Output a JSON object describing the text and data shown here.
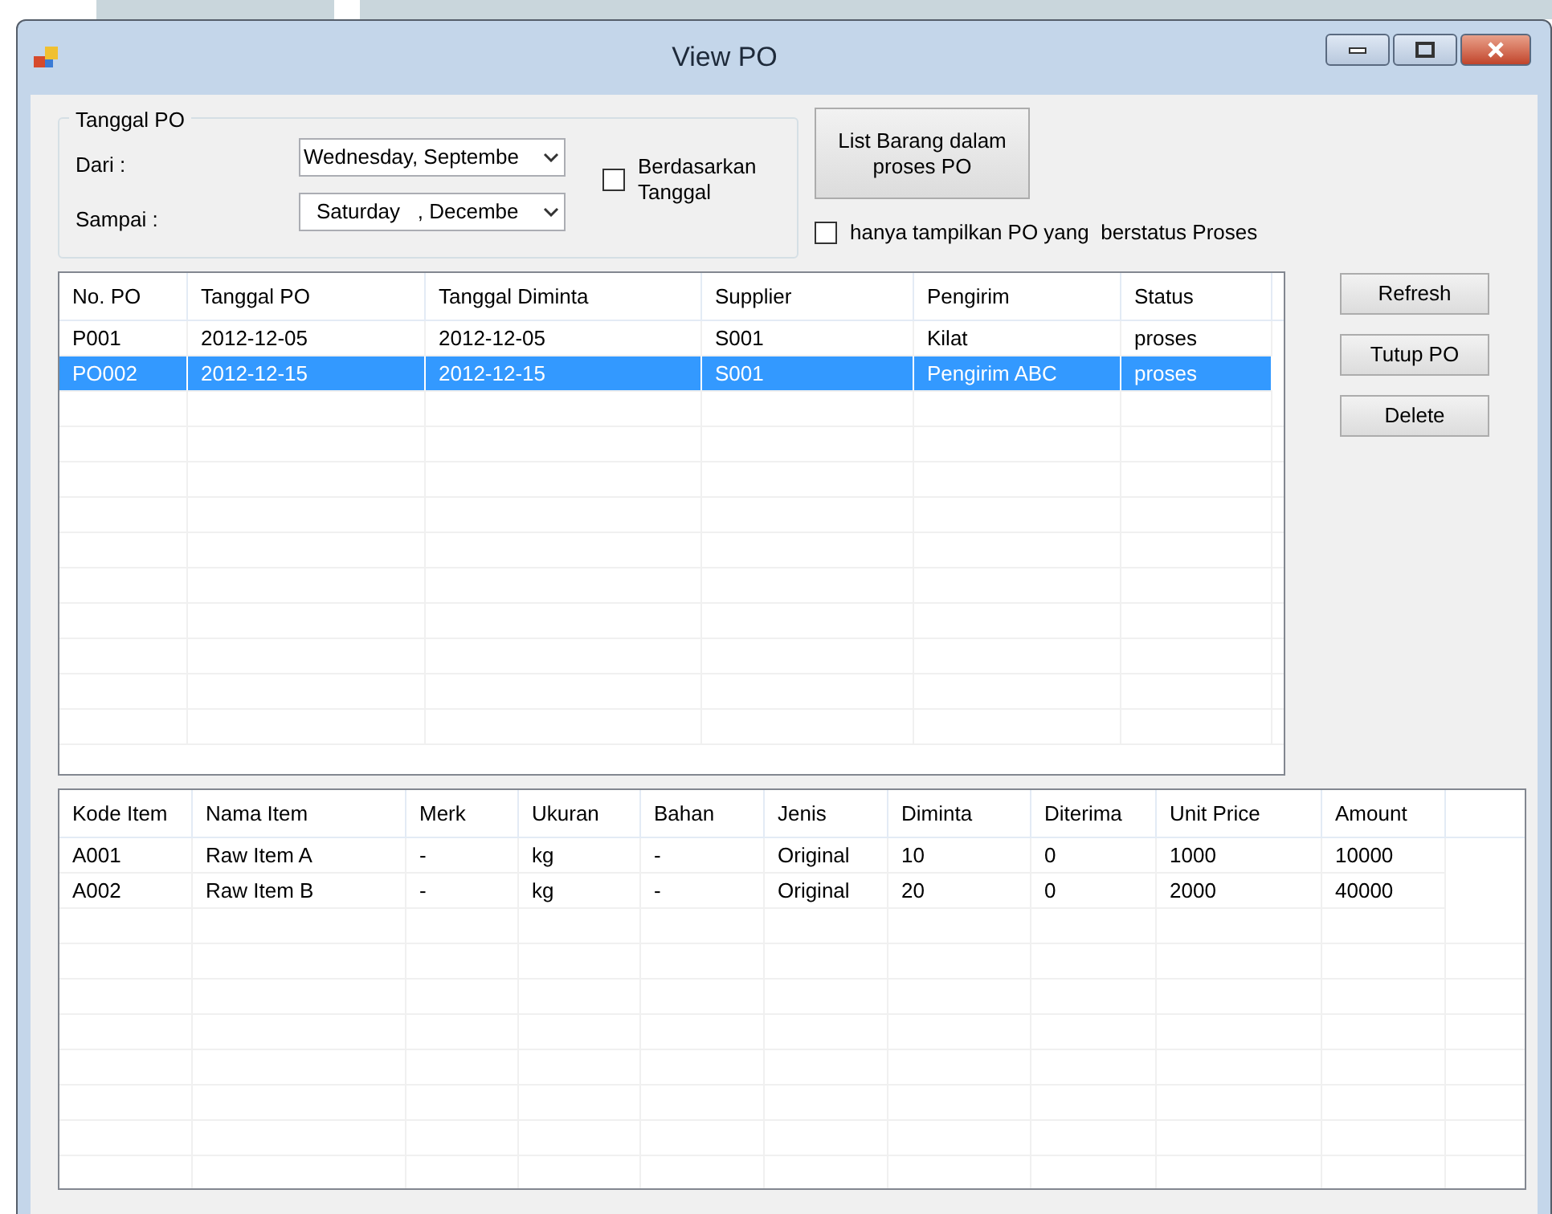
{
  "window": {
    "title": "View PO"
  },
  "filter": {
    "title": "Tanggal PO",
    "from_label": "Dari :",
    "from_value": "Wednesday, Septembe",
    "to_label": "Sampai :",
    "to_value": "Saturday   , Decembe",
    "by_date": {
      "label": "Berdasarkan Tanggal",
      "checked": false
    }
  },
  "list_button": "List Barang dalam proses PO",
  "only_process": {
    "label": "hanya tampilkan PO yang  berstatus Proses",
    "checked": false
  },
  "po_table": {
    "columns": [
      "No. PO",
      "Tanggal PO",
      "Tanggal Diminta",
      "Supplier",
      "Pengirim",
      "Status"
    ],
    "rows": [
      {
        "cells": [
          "P001",
          "2012-12-05",
          "2012-12-05",
          "S001",
          "Kilat",
          "proses"
        ],
        "selected": false
      },
      {
        "cells": [
          "PO002",
          "2012-12-15",
          "2012-12-15",
          "S001",
          "Pengirim ABC",
          "proses"
        ],
        "selected": true
      }
    ]
  },
  "side_buttons": [
    "Refresh",
    "Tutup PO",
    "Delete"
  ],
  "item_table": {
    "columns": [
      "Kode Item",
      "Nama Item",
      "Merk",
      "Ukuran",
      "Bahan",
      "Jenis",
      "Diminta",
      "Diterima",
      "Unit Price",
      "Amount"
    ],
    "rows": [
      {
        "cells": [
          "A001",
          "Raw Item A",
          "-",
          "kg",
          "-",
          "Original",
          "10",
          "0",
          "1000",
          "10000"
        ]
      },
      {
        "cells": [
          "A002",
          "Raw Item B",
          "-",
          "kg",
          "-",
          "Original",
          "20",
          "0",
          "2000",
          "40000"
        ]
      }
    ]
  }
}
